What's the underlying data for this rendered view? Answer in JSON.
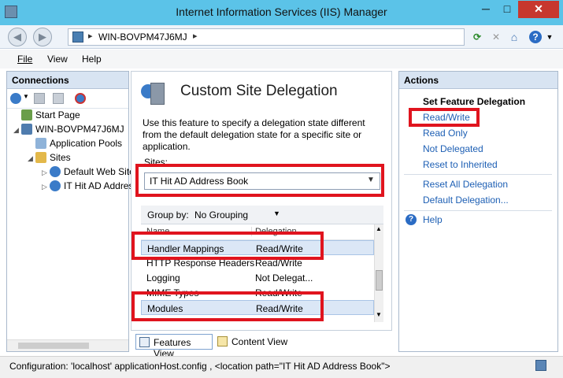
{
  "window": {
    "title": "Internet Information Services (IIS) Manager",
    "minimize": "─",
    "maximize": "□",
    "close": "✕"
  },
  "nav": {
    "back": "◀",
    "forward": "▶",
    "address_sep": "▸",
    "address_path": "WIN-BOVPM47J6MJ",
    "address_sep2": "▸",
    "refresh": "⟳",
    "stop": "✕",
    "home": "⌂",
    "help": "?"
  },
  "menu": {
    "file": "File",
    "view": "View",
    "help": "Help"
  },
  "connections": {
    "title": "Connections",
    "tree": [
      {
        "label": "Start Page",
        "toggle": "",
        "indent": 0
      },
      {
        "label": "WIN-BOVPM47J6MJ",
        "toggle": "◢",
        "indent": 0
      },
      {
        "label": "Application Pools",
        "toggle": "",
        "indent": 1
      },
      {
        "label": "Sites",
        "toggle": "◢",
        "indent": 1
      },
      {
        "label": "Default Web Site",
        "toggle": "▷",
        "indent": 2
      },
      {
        "label": "IT Hit AD Address Book",
        "toggle": "▷",
        "indent": 2
      }
    ]
  },
  "feature": {
    "title": "Custom Site Delegation",
    "description": "Use this feature to specify a delegation state different from the default delegation state for a specific site or application.",
    "sites_label": "Sites:",
    "sites_value": "IT Hit AD Address Book",
    "group_by_label": "Group by:",
    "group_by_value": "No Grouping",
    "columns": [
      "Name",
      "Delegation"
    ],
    "rows": [
      {
        "name": "Handler Mappings",
        "delegation": "Read/Write"
      },
      {
        "name": "HTTP Response Headers",
        "delegation": "Read/Write"
      },
      {
        "name": "Logging",
        "delegation": "Not Delegat..."
      },
      {
        "name": "MIME Types",
        "delegation": "Read/Write"
      },
      {
        "name": "Modules",
        "delegation": "Read/Write"
      }
    ],
    "tab_features": "Features View",
    "tab_content": "Content View"
  },
  "actions": {
    "title": "Actions",
    "section": "Set Feature Delegation",
    "read_write": "Read/Write",
    "read_only": "Read Only",
    "not_delegated": "Not Delegated",
    "reset_inherited": "Reset to Inherited",
    "reset_all": "Reset All Delegation",
    "default_delegation": "Default Delegation...",
    "help": "Help"
  },
  "status": {
    "text": "Configuration: 'localhost' applicationHost.config , <location path=\"IT Hit AD Address Book\">"
  },
  "colors": {
    "highlight_box": "#e0141e",
    "link": "#1d5fb4",
    "titlebar": "#5bc3e8"
  }
}
